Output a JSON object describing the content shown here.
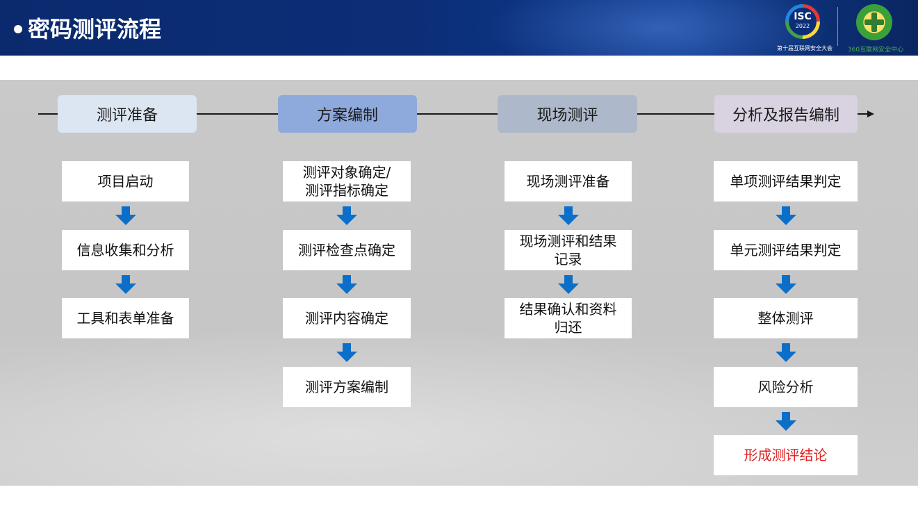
{
  "header": {
    "title": "密码测评流程",
    "logo_isc": {
      "text": "ISC",
      "year": "2022",
      "caption": "第十届互联网安全大会"
    },
    "logo_360": {
      "caption": "360互联网安全中心"
    }
  },
  "colors": {
    "header_bg": "#0c2e77",
    "phase_1": "#dce6f2",
    "phase_2": "#8ea9db",
    "phase_3": "#adb9ca",
    "phase_4": "#d9d2e0",
    "arrow": "#0b6fc9",
    "highlight_text": "#e02020"
  },
  "phases": [
    {
      "label": "测评准备",
      "steps": [
        "项目启动",
        "信息收集和分析",
        "工具和表单准备"
      ]
    },
    {
      "label": "方案编制",
      "steps": [
        "测评对象确定/\n测评指标确定",
        "测评检查点确定",
        "测评内容确定",
        "测评方案编制"
      ]
    },
    {
      "label": "现场测评",
      "steps": [
        "现场测评准备",
        "现场测评和结果\n记录",
        "结果确认和资料\n归还"
      ]
    },
    {
      "label": "分析及报告编制",
      "steps": [
        "单项测评结果判定",
        "单元测评结果判定",
        "整体测评",
        "风险分析",
        "形成测评结论"
      ]
    }
  ]
}
